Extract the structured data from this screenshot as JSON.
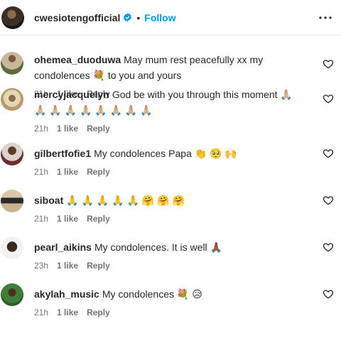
{
  "header": {
    "username": "cwesiotengofficial",
    "separator": "•",
    "follow_label": "Follow"
  },
  "comments": [
    {
      "username": "ohemea_duoduwa",
      "text": "May mum rest peacefully xx my condolences 💐  to you and yours",
      "time": "21h",
      "likes": "1 like",
      "reply": "Reply"
    },
    {
      "username": "mercyjacquelyn",
      "text": "God be with you through this moment 🙏🏼 🙏🏼 🙏🏼 🙏🏼 🙏🏼 🙏🏼 🙏🏼 🙏🏼 🙏🏼",
      "time": "21h",
      "likes": "1 like",
      "reply": "Reply"
    },
    {
      "username": "gilbertfofie1",
      "text": "My condolences Papa 👏 🥺 🙌",
      "time": "21h",
      "likes": "1 like",
      "reply": "Reply"
    },
    {
      "username": "siboat",
      "text": "🙏 🙏 🙏 🙏 🙏 🤗 🤗 🤗",
      "time": "21h",
      "likes": "1 like",
      "reply": "Reply"
    },
    {
      "username": "pearl_aikins",
      "text": "My condolences. It is well 🙏🏾",
      "time": "23h",
      "likes": "1 like",
      "reply": "Reply"
    },
    {
      "username": "akylah_music",
      "text": "My condolences 💐  😥",
      "time": "21h",
      "likes": "1 like",
      "reply": "Reply"
    }
  ],
  "colors": {
    "accent": "#0095f6",
    "text": "#262626",
    "meta": "#737373"
  }
}
